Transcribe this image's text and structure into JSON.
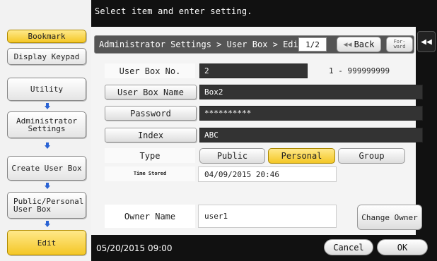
{
  "top_message": "Select item and enter setting.",
  "status": {
    "datetime": "05/20/2015  09:00"
  },
  "left_panel": {
    "bookmark": "Bookmark",
    "display_keypad": "Display Keypad",
    "utility": "Utility",
    "admin_settings": "Administrator Settings",
    "create_user_box": "Create User Box",
    "public_personal": "Public/Personal User Box",
    "edit": "Edit"
  },
  "header": {
    "breadcrumb": "Administrator Settings > User Box > Edit",
    "page": "1/2",
    "back": "Back",
    "forward": "For- ward"
  },
  "form": {
    "box_no_label": "User Box No.",
    "box_no_value": "2",
    "box_no_range": "1 - 999999999",
    "box_name_label": "User Box Name",
    "box_name_value": "Box2",
    "password_label": "Password",
    "password_value": "**********",
    "index_label": "Index",
    "index_value": "ABC",
    "type_label": "Type",
    "type_options": [
      "Public",
      "Personal",
      "Group"
    ],
    "type_selected": "Personal",
    "time_stored_label": "Time Stored",
    "time_stored_value": "04/09/2015  20:46",
    "owner_label": "Owner Name",
    "owner_value": "user1",
    "change_owner": "Change Owner"
  },
  "footer": {
    "cancel": "Cancel",
    "ok": "OK"
  },
  "colors": {
    "accent_yellow": "#f4c726",
    "frame_dark": "#111111",
    "arrow_blue": "#2a63d4"
  }
}
